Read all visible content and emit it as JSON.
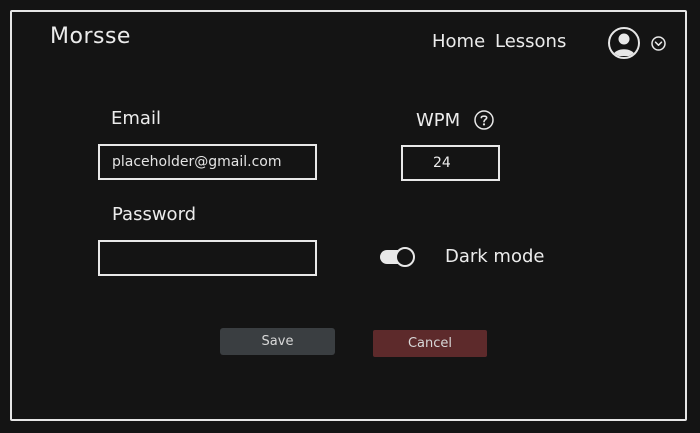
{
  "app": {
    "name": "Morsse"
  },
  "nav": {
    "home": "Home",
    "lessons": "Lessons"
  },
  "user_menu": {
    "avatar_icon": "user-avatar-icon",
    "dropdown_icon": "chevron-down-circle-icon"
  },
  "form": {
    "email": {
      "label": "Email",
      "placeholder": "placeholder@gmail.com",
      "value": ""
    },
    "password": {
      "label": "Password",
      "value": ""
    },
    "wpm": {
      "label": "WPM",
      "value": "24",
      "help_icon": "question-circle-icon"
    },
    "dark_mode": {
      "label": "Dark mode",
      "enabled": true
    }
  },
  "actions": {
    "save": "Save",
    "cancel": "Cancel"
  },
  "colors": {
    "background": "#141414",
    "foreground": "#e8e8e8",
    "save_button": "#3a3e41",
    "cancel_button": "#5d2a2b"
  }
}
